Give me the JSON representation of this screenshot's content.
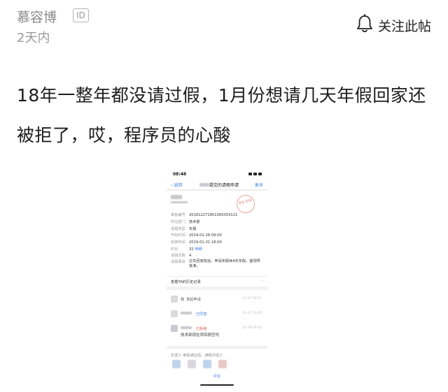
{
  "post": {
    "author": "慕容博",
    "id_badge": "ID",
    "time": "2天内",
    "follow_label": "关注此帖",
    "title": "18年一整年都没请过假，1月份想请几天年假回家还被拒了，哎，程序员的心酸"
  },
  "screenshot": {
    "status_time": "08:48",
    "nav_back": "返回",
    "nav_title_suffix": "提交的请假申请",
    "nav_more": "更多",
    "stamp_text": "审批 拒绝",
    "fields": [
      {
        "key": "审批编号",
        "value": "201812271851000354121"
      },
      {
        "key": "所在部门",
        "value": "技术部"
      },
      {
        "key": "请假类型",
        "value": "年假"
      },
      {
        "key": "开始时间",
        "value": "2019-01-28 09:00"
      },
      {
        "key": "结束时间",
        "value": "2019-01-31 18:00"
      },
      {
        "key": "时长",
        "value": "32",
        "link": "明细"
      },
      {
        "key": "请假天数",
        "value": "4"
      }
    ],
    "reason_key": "请假事由",
    "reason_value": "过年回家较远，申请年假休4天年假，望领导批准。",
    "history_label": "查看TA的历史记录",
    "history_chevron": "›",
    "steps": [
      {
        "name": "我",
        "status": "发起申请",
        "time": "12-27 18:51"
      },
      {
        "name": "",
        "status": "已同意",
        "time": "12-27 19:20"
      },
      {
        "name": "",
        "status": "已拒绝",
        "time": "12-28 09:42",
        "comment": "技术部现在项目很空吗"
      }
    ],
    "cc_label": "抄送人  审批通过后，通知抄送人",
    "comment_label": "评论"
  },
  "colors": {
    "link_blue": "#3a7ee6",
    "reject_red": "#e05a4f",
    "meta_gray": "#8a8a8a"
  },
  "icons": {
    "follow": "bell-icon"
  }
}
